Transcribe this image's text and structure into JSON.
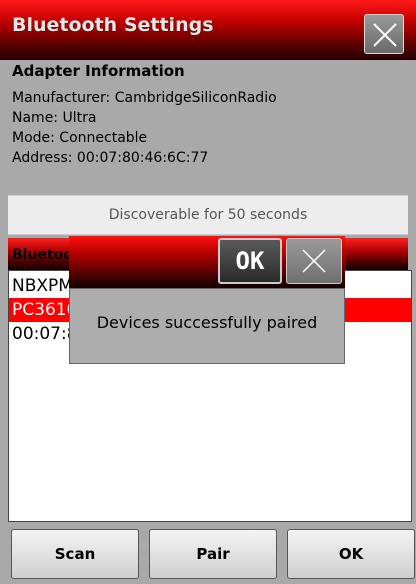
{
  "window": {
    "title": "Bluetooth Settings"
  },
  "adapter": {
    "heading": "Adapter Information",
    "manufacturer": "Manufacturer: CambridgeSiliconRadio",
    "name": "Name: Ultra",
    "mode": "Mode: Connectable",
    "address": "Address: 00:07:80:46:6C:77"
  },
  "discoverable": {
    "text": "Discoverable for 50 seconds"
  },
  "devices": {
    "heading": "Bluetoot",
    "items": [
      {
        "label": "NBXPME"
      },
      {
        "label": "PC3610"
      },
      {
        "label": "00:07:8"
      }
    ],
    "selected_index": 1
  },
  "buttons": {
    "scan": "Scan",
    "pair": "Pair",
    "ok": "OK"
  },
  "dialog": {
    "ok_label": "OK",
    "message": "Devices successfully paired"
  },
  "colors": {
    "accent": "#ff0000",
    "background": "#a9a9a9"
  }
}
